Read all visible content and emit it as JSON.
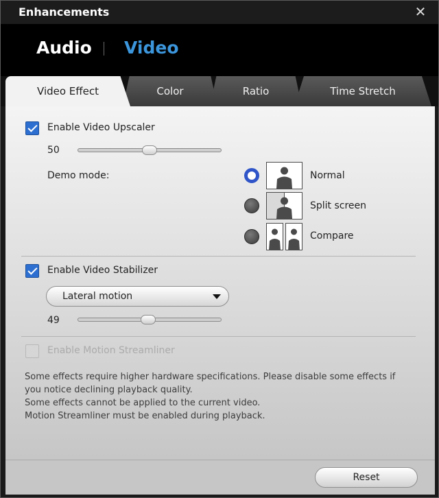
{
  "window": {
    "title": "Enhancements",
    "close_icon": "close-icon"
  },
  "modes": [
    {
      "label": "Audio",
      "active": false
    },
    {
      "label": "Video",
      "active": true,
      "color": "#3c96dc"
    }
  ],
  "tabs": [
    {
      "label": "Video Effect",
      "active": true
    },
    {
      "label": "Color",
      "active": false
    },
    {
      "label": "Ratio",
      "active": false
    },
    {
      "label": "Time Stretch",
      "active": false
    }
  ],
  "upscaler": {
    "label": "Enable Video Upscaler",
    "checked": true,
    "value": "50",
    "value_fraction": 0.5,
    "demo_label": "Demo mode:",
    "demo_options": [
      {
        "label": "Normal",
        "selected": true
      },
      {
        "label": "Split screen",
        "selected": false
      },
      {
        "label": "Compare",
        "selected": false
      }
    ]
  },
  "stabilizer": {
    "label": "Enable Video Stabilizer",
    "checked": true,
    "mode": "Lateral motion",
    "value": "49",
    "value_fraction": 0.49
  },
  "streamliner": {
    "label": "Enable Motion Streamliner",
    "checked": false,
    "enabled": false
  },
  "notes": [
    "Some effects require higher hardware specifications. Please disable some effects if",
    "you notice declining playback quality.",
    "Some effects cannot be applied to the current video.",
    "Motion Streamliner must be enabled during playback."
  ],
  "footer": {
    "reset_label": "Reset"
  },
  "colors": {
    "accent": "#2c6fd0",
    "video_mode": "#3c96dc",
    "radio_selected": "#2f55c8"
  }
}
